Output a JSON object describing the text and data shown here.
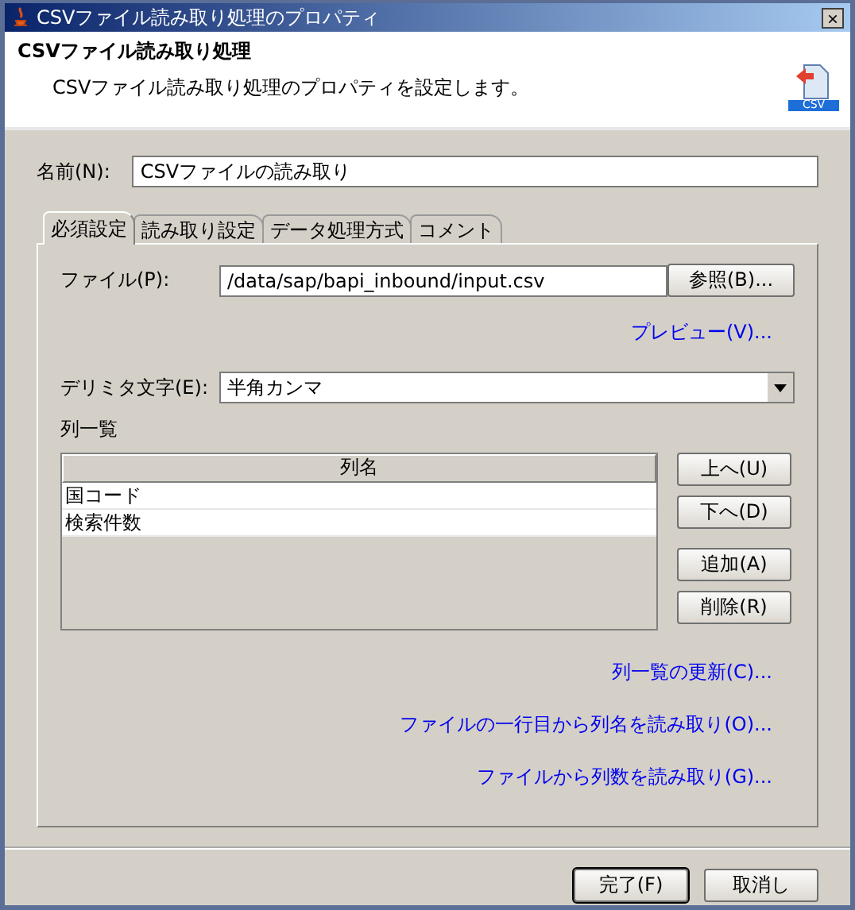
{
  "window": {
    "title": "CSVファイル読み取り処理のプロパティ",
    "close": "×"
  },
  "header": {
    "title": "CSVファイル読み取り処理",
    "description": "CSVファイル読み取り処理のプロパティを設定します。",
    "icon_label": "CSV"
  },
  "name_field": {
    "label": "名前(N):",
    "value": "CSVファイルの読み取り"
  },
  "tabs": [
    {
      "label": "必須設定",
      "selected": true
    },
    {
      "label": "読み取り設定",
      "selected": false
    },
    {
      "label": "データ処理方式",
      "selected": false
    },
    {
      "label": "コメント",
      "selected": false
    }
  ],
  "file_field": {
    "label": "ファイル(P):",
    "value": "/data/sap/bapi_inbound/input.csv",
    "button": "参照(B)..."
  },
  "preview_link": "プレビュー(V)...",
  "delimiter": {
    "label": "デリミタ文字(E):",
    "value": "半角カンマ"
  },
  "column_list": {
    "label": "列一覧",
    "header": "列名",
    "rows": [
      "国コード",
      "検索件数"
    ]
  },
  "list_buttons": [
    "上へ(U)",
    "下へ(D)",
    "追加(A)",
    "削除(R)"
  ],
  "links": [
    "列一覧の更新(C)...",
    "ファイルの一行目から列名を読み取り(O)...",
    "ファイルから列数を読み取り(G)..."
  ],
  "buttons": [
    {
      "label": "完了(F)",
      "default": true
    },
    {
      "label": "取消し",
      "default": false
    }
  ]
}
